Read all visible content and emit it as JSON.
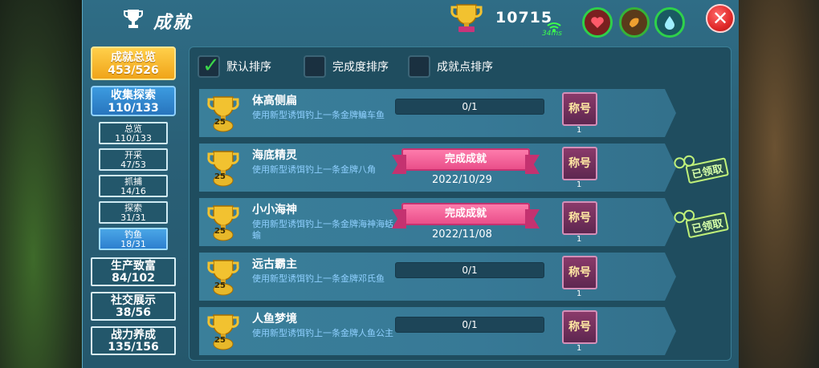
{
  "header": {
    "title": "成就",
    "points": "10715",
    "ping": "34ms"
  },
  "nav": {
    "overview": {
      "label": "成就总览",
      "count": "453/526"
    },
    "collect": {
      "label": "收集探索",
      "count": "110/133"
    },
    "subs": [
      {
        "label": "总览",
        "count": "110/133"
      },
      {
        "label": "开采",
        "count": "47/53"
      },
      {
        "label": "抓捕",
        "count": "14/16"
      },
      {
        "label": "探索",
        "count": "31/31"
      },
      {
        "label": "钓鱼",
        "count": "18/31"
      }
    ],
    "mains": [
      {
        "label": "生产致富",
        "count": "84/102"
      },
      {
        "label": "社交展示",
        "count": "38/56"
      },
      {
        "label": "战力养成",
        "count": "135/156"
      }
    ]
  },
  "sort": {
    "default": "默认排序",
    "completion": "完成度排序",
    "points": "成就点排序"
  },
  "achievements": [
    {
      "name": "体高侧扁",
      "desc": "使用新型诱饵钓上一条金牌鳊车鱼",
      "points": "25",
      "progress": "0/1",
      "reward": "称号",
      "reward_count": "1"
    },
    {
      "name": "海底精灵",
      "desc": "使用新型诱饵钓上一条金牌八角",
      "points": "25",
      "status": "完成成就",
      "date": "2022/10/29",
      "reward": "称号",
      "reward_count": "1",
      "claimed": "已领取"
    },
    {
      "name": "小小海神",
      "desc": "使用新型诱饵钓上一条金牌海神海蛞蝓",
      "points": "25",
      "status": "完成成就",
      "date": "2022/11/08",
      "reward": "称号",
      "reward_count": "1",
      "claimed": "已领取"
    },
    {
      "name": "远古霸主",
      "desc": "使用新型诱饵钓上一条金牌邓氏鱼",
      "points": "25",
      "progress": "0/1",
      "reward": "称号",
      "reward_count": "1"
    },
    {
      "name": "人鱼梦境",
      "desc": "使用新型诱饵钓上一条金牌人鱼公主",
      "points": "25",
      "progress": "0/1",
      "reward": "称号",
      "reward_count": "1"
    }
  ]
}
